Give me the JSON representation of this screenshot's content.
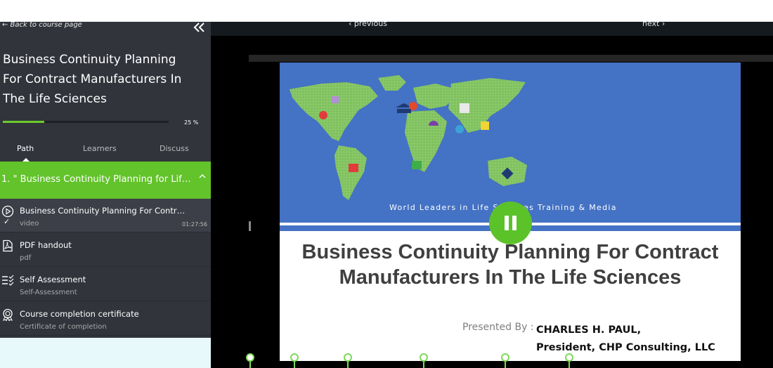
{
  "sidebar": {
    "back_label": "← Back to course page",
    "collapse_icon": "double-chevron-left-icon",
    "course_title": "Business Continuity Planning For Contract Manufacturers In The Life Sciences",
    "progress_percent": 25,
    "progress_label": "25 %",
    "tabs": [
      {
        "label": "Path",
        "active": true
      },
      {
        "label": "Learners",
        "active": false
      },
      {
        "label": "Discuss",
        "active": false
      }
    ],
    "section": {
      "label": "1. \" Business Continuity Planning for Life S...",
      "icon": "chevron-up-icon"
    },
    "items": [
      {
        "title": "Business Continuity Planning For Contract ...",
        "subtitle": "video",
        "duration": "01:27:56",
        "icon": "play-circle-icon",
        "completed": true
      },
      {
        "title": "PDF handout",
        "subtitle": "pdf",
        "icon": "pdf-icon"
      },
      {
        "title": "Self Assessment",
        "subtitle": "Self-Assessment",
        "icon": "checklist-icon"
      },
      {
        "title": "Course completion certificate",
        "subtitle": "Certificate of completion",
        "icon": "certificate-icon"
      }
    ]
  },
  "player": {
    "previous_label": "‹ previous",
    "next_label": "next ›",
    "slide": {
      "tagline": "World Leaders in Life Sciences Training & Media",
      "title": "Business Continuity Planning For Contract Manufacturers In The Life Sciences",
      "presented_by": "Presented By :",
      "presenter_name": "CHARLES H. PAUL,",
      "presenter_role": "President, CHP Consulting, LLC"
    },
    "pause_icon": "pause-icon"
  },
  "colors": {
    "sidebar_bg": "#32343c",
    "accent_green": "#62c32a",
    "slide_blue": "#4472c4"
  }
}
